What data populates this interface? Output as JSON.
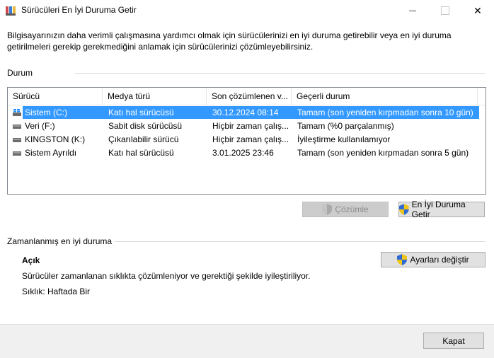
{
  "window": {
    "title": "Sürücüleri En İyi Duruma Getir",
    "controls": {
      "minimize": "—",
      "close": "✕"
    }
  },
  "intro_text": "Bilgisayarınızın daha verimli çalışmasına yardımcı olmak için sürücülerinizi en iyi duruma getirebilir veya en iyi duruma getirilmeleri gerekip gerekmediğini anlamak için sürücülerinizi çözümleyebilirsiniz.",
  "status": {
    "label": "Durum",
    "columns": [
      "Sürücü",
      "Medya türü",
      "Son çözümlenen v...",
      "Geçerli durum"
    ],
    "rows": [
      {
        "drive": "Sistem (C:)",
        "media": "Katı hal sürücüsü",
        "last": "30.12.2024 08:14",
        "state": "Tamam (son yeniden kırpmadan sonra 10 gün)",
        "selected": true,
        "icon": "windows-drive-icon"
      },
      {
        "drive": "Veri (F:)",
        "media": "Sabit disk sürücüsü",
        "last": "Hiçbir zaman çalış...",
        "state": "Tamam (%0 parçalanmış)",
        "icon": "hard-drive-icon"
      },
      {
        "drive": "KINGSTON (K:)",
        "media": "Çıkarılabilir sürücü",
        "last": "Hiçbir zaman çalış...",
        "state": "İyileştirme kullanılamıyor",
        "icon": "hard-drive-icon"
      },
      {
        "drive": "Sistem Ayrıldı",
        "media": "Katı hal sürücüsü",
        "last": "3.01.2025 23:46",
        "state": "Tamam (son yeniden kırpmadan sonra 5 gün)",
        "icon": "hard-drive-icon"
      }
    ],
    "analyze_button": "Çözümle",
    "optimize_button": "En İyi Duruma Getir"
  },
  "scheduled": {
    "label": "Zamanlanmış en iyi duruma",
    "state": "Açık",
    "description": "Sürücüler zamanlanan sıklıkta çözümleniyor ve gerektiği şekilde iyileştiriliyor.",
    "frequency": "Sıklık: Haftada Bir",
    "change_settings_button": "Ayarları değiştir"
  },
  "close_button": "Kapat",
  "colors": {
    "selection": "#3399ff",
    "window_bg": "#f0f0f0"
  }
}
